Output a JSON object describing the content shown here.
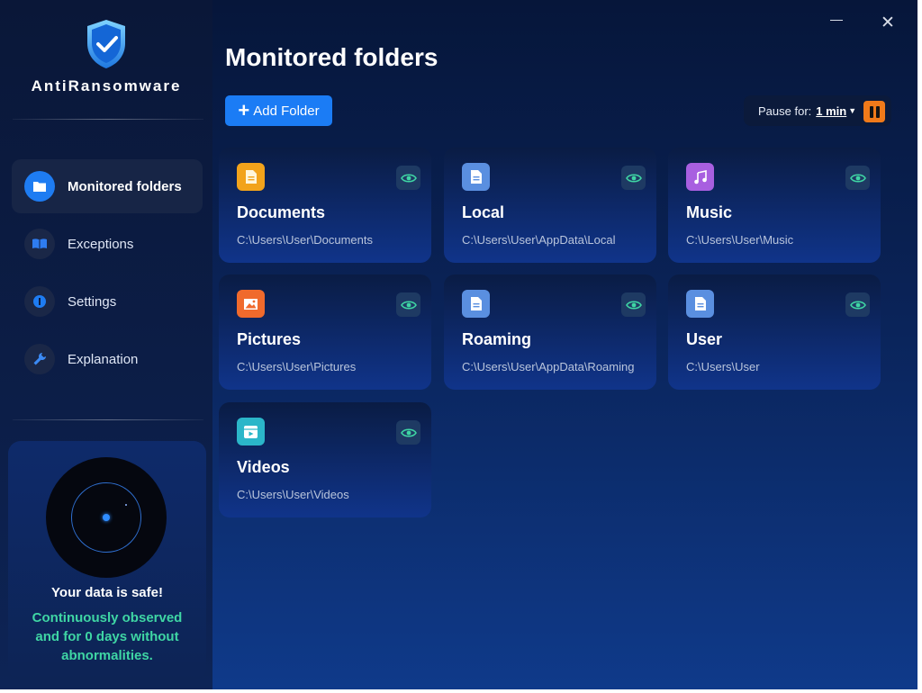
{
  "app": {
    "name": "AntiRansomware"
  },
  "window": {
    "minimize": "minimize",
    "close": "✕"
  },
  "sidebar": {
    "items": [
      {
        "label": "Monitored folders",
        "icon": "folder-icon",
        "active": true
      },
      {
        "label": "Exceptions",
        "icon": "book-icon",
        "active": false
      },
      {
        "label": "Settings",
        "icon": "settings-icon",
        "active": false
      },
      {
        "label": "Explanation",
        "icon": "wrench-icon",
        "active": false
      }
    ]
  },
  "status": {
    "title": "Your data is safe!",
    "description": "Continuously observed and for 0 days without abnormalities."
  },
  "main": {
    "title": "Monitored folders",
    "add_label": "Add Folder",
    "pause_label": "Pause for:",
    "pause_value": "1 min"
  },
  "folders": [
    {
      "name": "Documents",
      "path": "C:\\Users\\User\\Documents",
      "icon": "document-icon",
      "color": "#f2a31b"
    },
    {
      "name": "Local",
      "path": "C:\\Users\\User\\AppData\\Local",
      "icon": "file-icon",
      "color": "#5a8fe0"
    },
    {
      "name": "Music",
      "path": "C:\\Users\\User\\Music",
      "icon": "music-icon",
      "color": "#a85fe0"
    },
    {
      "name": "Pictures",
      "path": "C:\\Users\\User\\Pictures",
      "icon": "image-icon",
      "color": "#f06a2c"
    },
    {
      "name": "Roaming",
      "path": "C:\\Users\\User\\AppData\\Roaming",
      "icon": "file-icon",
      "color": "#5a8fe0"
    },
    {
      "name": "User",
      "path": "C:\\Users\\User",
      "icon": "file-icon",
      "color": "#5a8fe0"
    },
    {
      "name": "Videos",
      "path": "C:\\Users\\User\\Videos",
      "icon": "video-icon",
      "color": "#2bb6c9"
    }
  ],
  "colors": {
    "accent": "#1b7cf5",
    "safe": "#3fd6a4",
    "pause": "#f07a1a"
  }
}
